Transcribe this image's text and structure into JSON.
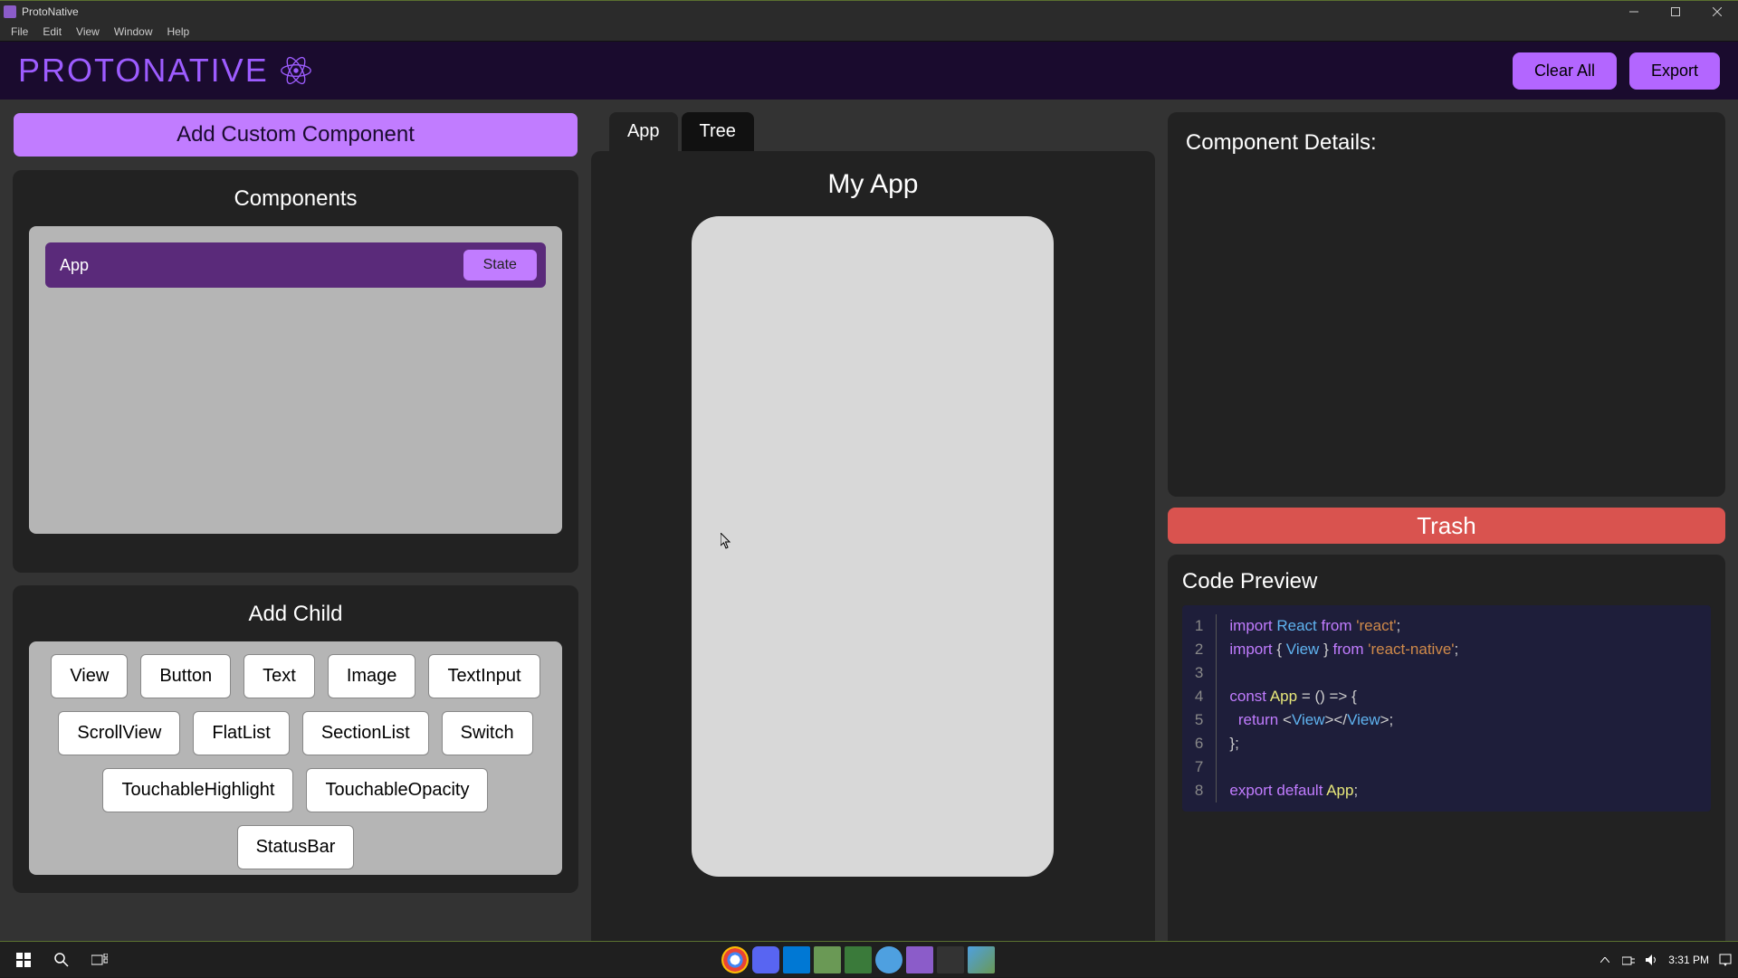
{
  "window": {
    "title": "ProtoNative"
  },
  "menubar": [
    "File",
    "Edit",
    "View",
    "Window",
    "Help"
  ],
  "header": {
    "logo": "PROTONATIVE",
    "clear_all": "Clear All",
    "export": "Export"
  },
  "left": {
    "add_custom": "Add Custom Component",
    "components_title": "Components",
    "components": [
      {
        "name": "App",
        "state_label": "State"
      }
    ],
    "add_child_title": "Add Child",
    "child_elements": [
      "View",
      "Button",
      "Text",
      "Image",
      "TextInput",
      "ScrollView",
      "FlatList",
      "SectionList",
      "Switch",
      "TouchableHighlight",
      "TouchableOpacity",
      "StatusBar"
    ]
  },
  "mid": {
    "tabs": [
      "App",
      "Tree"
    ],
    "active_tab": 0,
    "canvas_title": "My App"
  },
  "right": {
    "details_title": "Component Details:",
    "trash": "Trash",
    "code_title": "Code Preview",
    "code_lines": [
      "import React from 'react';",
      "import { View } from 'react-native';",
      "",
      "const App = () => {",
      "  return <View></View>;",
      "};",
      "",
      "export default App;"
    ]
  },
  "taskbar": {
    "time": "3:31 PM"
  }
}
